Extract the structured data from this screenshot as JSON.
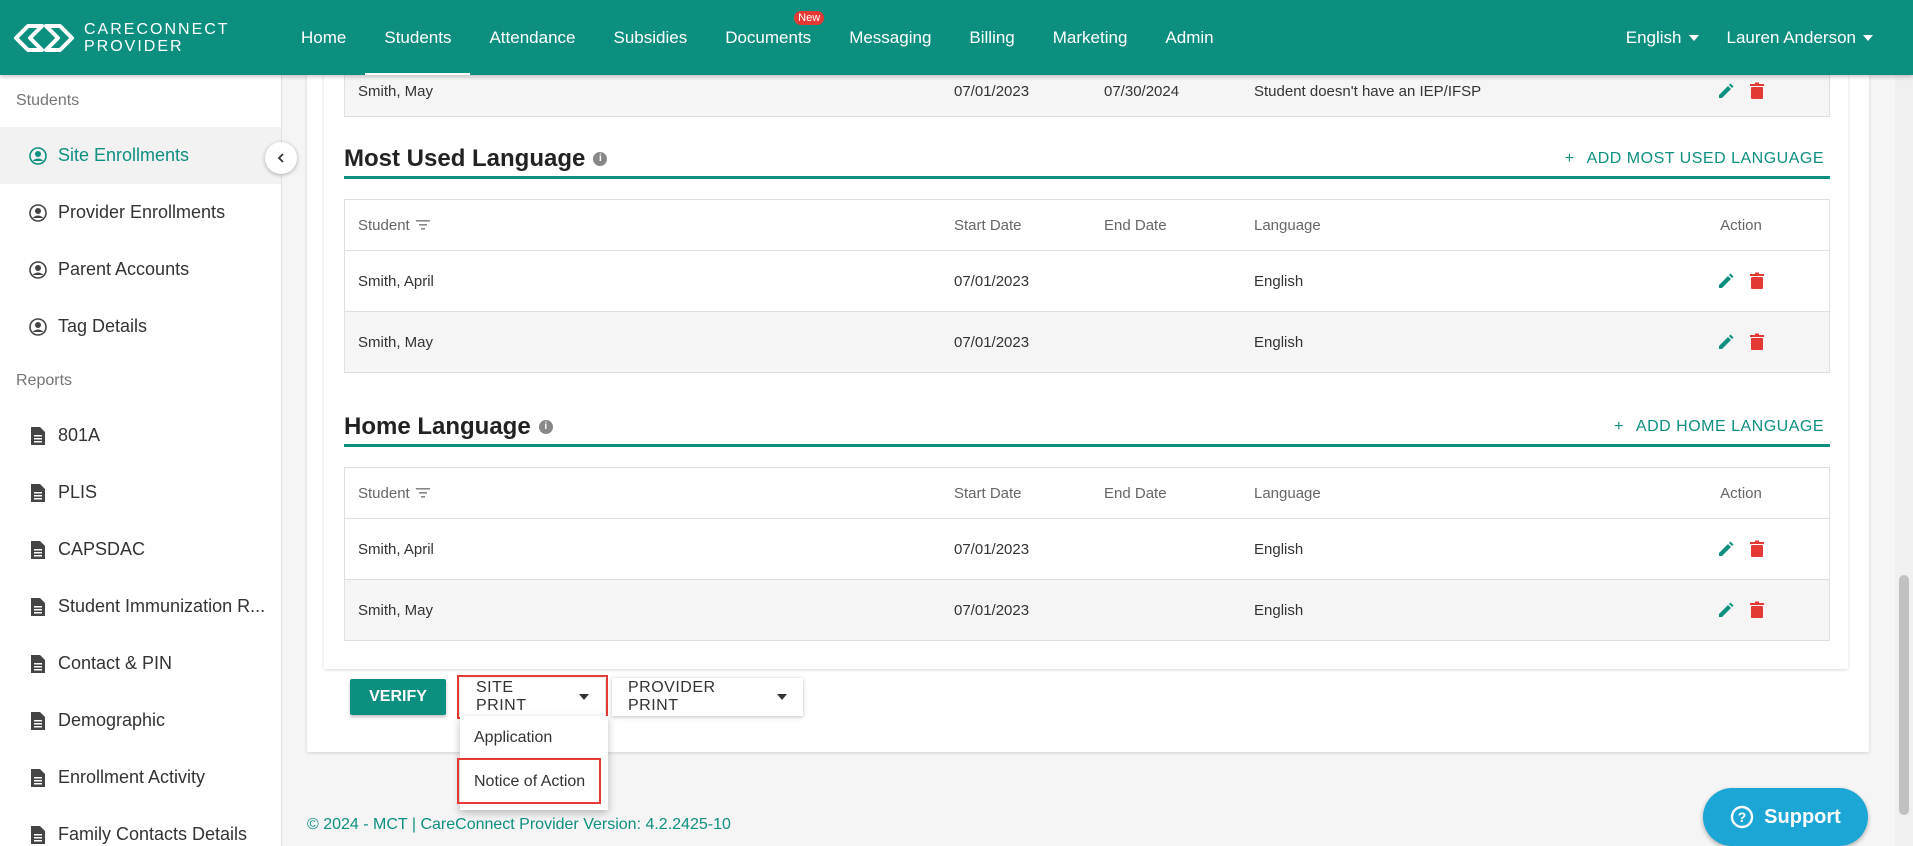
{
  "app": {
    "logo_line1": "CARECONNECT",
    "logo_line2": "PROVIDER",
    "colors": {
      "primary": "#0d8f80",
      "danger": "#e53935",
      "support": "#1ba6d6"
    }
  },
  "nav": {
    "items": [
      {
        "label": "Home"
      },
      {
        "label": "Students"
      },
      {
        "label": "Attendance"
      },
      {
        "label": "Subsidies"
      },
      {
        "label": "Documents",
        "badge": "New"
      },
      {
        "label": "Messaging"
      },
      {
        "label": "Billing"
      },
      {
        "label": "Marketing"
      },
      {
        "label": "Admin"
      }
    ],
    "active": "Students",
    "language": "English",
    "user": "Lauren Anderson"
  },
  "sidebar": {
    "sections": [
      {
        "title": "Students",
        "items": [
          {
            "label": "Site Enrollments",
            "icon": "person-circle-icon"
          },
          {
            "label": "Provider Enrollments",
            "icon": "person-circle-icon"
          },
          {
            "label": "Parent Accounts",
            "icon": "person-circle-icon"
          },
          {
            "label": "Tag Details",
            "icon": "person-circle-icon"
          }
        ]
      },
      {
        "title": "Reports",
        "items": [
          {
            "label": "801A",
            "icon": "document-icon"
          },
          {
            "label": "PLIS",
            "icon": "document-icon"
          },
          {
            "label": "CAPSDAC",
            "icon": "document-icon"
          },
          {
            "label": "Student Immunization R...",
            "icon": "document-icon"
          },
          {
            "label": "Contact & PIN",
            "icon": "document-icon"
          },
          {
            "label": "Demographic",
            "icon": "document-icon"
          },
          {
            "label": "Enrollment Activity",
            "icon": "document-icon"
          },
          {
            "label": "Family Contacts Details",
            "icon": "document-icon"
          }
        ]
      }
    ]
  },
  "partial_row": {
    "student": "Smith, May",
    "start": "07/01/2023",
    "end": "07/30/2024",
    "note": "Student doesn't have an IEP/IFSP"
  },
  "most_used_language": {
    "title": "Most Used Language",
    "add_label": "ADD MOST USED LANGUAGE",
    "columns": [
      "Student",
      "Start Date",
      "End Date",
      "Language",
      "Action"
    ],
    "rows": [
      {
        "student": "Smith, April",
        "start": "07/01/2023",
        "end": "",
        "language": "English"
      },
      {
        "student": "Smith, May",
        "start": "07/01/2023",
        "end": "",
        "language": "English"
      }
    ]
  },
  "home_language": {
    "title": "Home Language",
    "add_label": "ADD HOME LANGUAGE",
    "columns": [
      "Student",
      "Start Date",
      "End Date",
      "Language",
      "Action"
    ],
    "rows": [
      {
        "student": "Smith, April",
        "start": "07/01/2023",
        "end": "",
        "language": "English"
      },
      {
        "student": "Smith, May",
        "start": "07/01/2023",
        "end": "",
        "language": "English"
      }
    ]
  },
  "actions": {
    "verify": "VERIFY",
    "site_print": "SITE PRINT",
    "provider_print": "PROVIDER PRINT",
    "site_print_menu": [
      "Application",
      "Notice of Action"
    ]
  },
  "footer": {
    "text": "© 2024 - MCT | CareConnect Provider Version: 4.2.2425-10"
  },
  "support": {
    "label": "Support"
  }
}
